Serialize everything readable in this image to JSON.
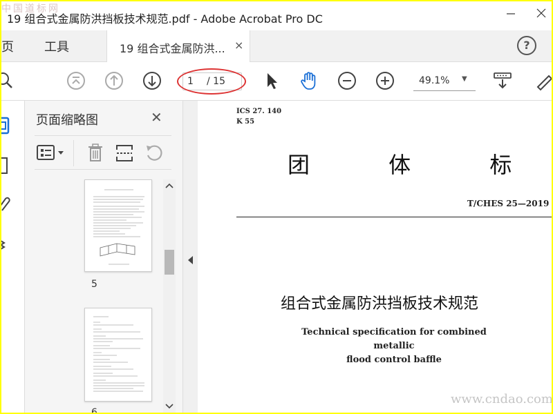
{
  "window": {
    "title": "19 组合式金属防洪挡板技术规范.pdf - Adobe Acrobat Pro DC",
    "minimize_icon": "minimize-icon",
    "close_icon": "close-icon"
  },
  "watermarks": {
    "top": "中国道标网",
    "bottom": "www.cndao.com"
  },
  "tabs": {
    "home": "主页",
    "tools": "工具",
    "document": "19 组合式金属防洪...",
    "close_glyph": "×",
    "help_glyph": "?"
  },
  "toolbar": {
    "page_current": "1",
    "page_total": "/ 15",
    "zoom": "49.1%",
    "zoom_caret": "▼",
    "icons": [
      "search-icon",
      "prev-section-icon",
      "page-up-icon",
      "page-down-icon",
      "select-arrow-icon",
      "hand-icon",
      "zoom-out-icon",
      "zoom-in-icon",
      "scroll-mode-icon",
      "annotate-icon"
    ]
  },
  "panel": {
    "title": "页面缩略图",
    "close_glyph": "✕",
    "thumbnails": [
      {
        "label": "5"
      },
      {
        "label": "6"
      }
    ],
    "icons": [
      "options-icon",
      "delete-icon",
      "insert-icon",
      "rotate-icon",
      "scroll-up-icon",
      "scroll-down-icon"
    ]
  },
  "document": {
    "ics": "ICS 27. 140",
    "k": "K 55",
    "category": "团 体 标 准",
    "std_no": "T/CHES 25—2019",
    "title_cn": "组合式金属防洪挡板技术规范",
    "title_en_line1": "Technical specification for combined metallic",
    "title_en_line2": "flood control baffle"
  },
  "colors": {
    "hand_tool": "#1a6fd6",
    "ellipse": "#dd3333",
    "border": "#ffff00"
  }
}
